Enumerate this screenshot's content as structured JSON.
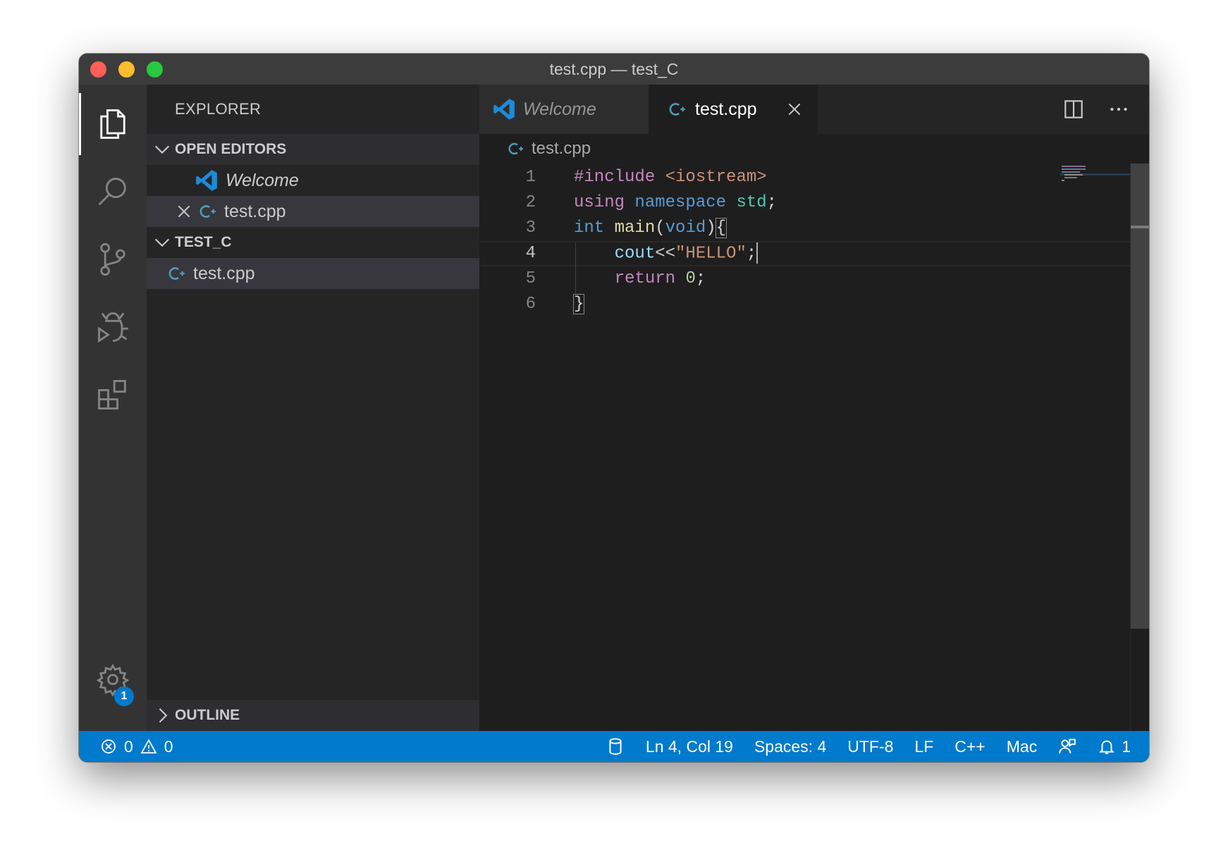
{
  "window": {
    "title": "test.cpp — test_C"
  },
  "sidebar": {
    "header": "EXPLORER",
    "open_editors": {
      "label": "OPEN EDITORS",
      "items": [
        {
          "label": "Welcome",
          "icon": "vscode-icon"
        },
        {
          "label": "test.cpp",
          "icon": "cpp-file-icon"
        }
      ]
    },
    "folder": {
      "label": "TEST_C",
      "items": [
        {
          "label": "test.cpp",
          "icon": "cpp-file-icon"
        }
      ]
    },
    "outline": "OUTLINE"
  },
  "activity_bar": {
    "items": [
      "explorer-icon",
      "search-icon",
      "source-control-icon",
      "debug-icon",
      "extensions-icon"
    ],
    "settings_badge": "1"
  },
  "tabs": [
    {
      "label": "Welcome",
      "active": false
    },
    {
      "label": "test.cpp",
      "active": true
    }
  ],
  "breadcrumb": "test.cpp",
  "code": {
    "line_numbers": [
      "1",
      "2",
      "3",
      "4",
      "5",
      "6"
    ],
    "lines": [
      "#include <iostream>",
      "using namespace std;",
      "int main(void){",
      "    cout<<\"HELLO\";",
      "    return 0;",
      "}"
    ],
    "current_line": 4
  },
  "status": {
    "errors": "0",
    "warnings": "0",
    "position": "Ln 4, Col 19",
    "spaces": "Spaces: 4",
    "encoding": "UTF-8",
    "eol": "LF",
    "language": "C++",
    "platform": "Mac",
    "notifications": "1"
  },
  "colors": {
    "accent": "#007acc",
    "titlebar": "#3c3c3c",
    "activity_bar": "#333333",
    "sidebar": "#252526",
    "editor": "#1e1e1e"
  }
}
